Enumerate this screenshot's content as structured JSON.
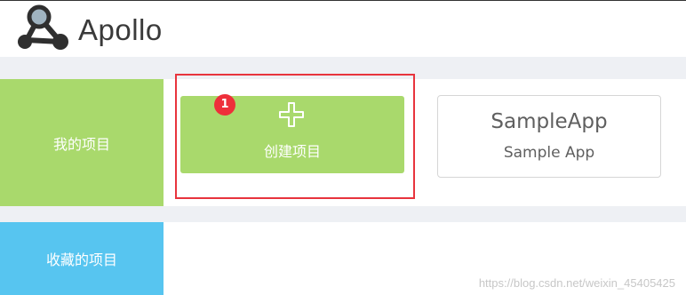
{
  "header": {
    "app_name": "Apollo",
    "logo_icon": "apollo-logo-icon"
  },
  "sections": {
    "my_projects_label": "我的项目",
    "favorite_projects_label": "收藏的项目"
  },
  "create_card": {
    "label": "创建项目",
    "icon": "plus-icon",
    "badge": "1"
  },
  "projects": [
    {
      "name": "SampleApp",
      "description": "Sample App"
    }
  ],
  "watermark": "https://blog.csdn.net/weixin_45405425",
  "colors": {
    "green": "#a9d96c",
    "blue": "#57c5f0",
    "highlight_red": "#e8343d"
  }
}
